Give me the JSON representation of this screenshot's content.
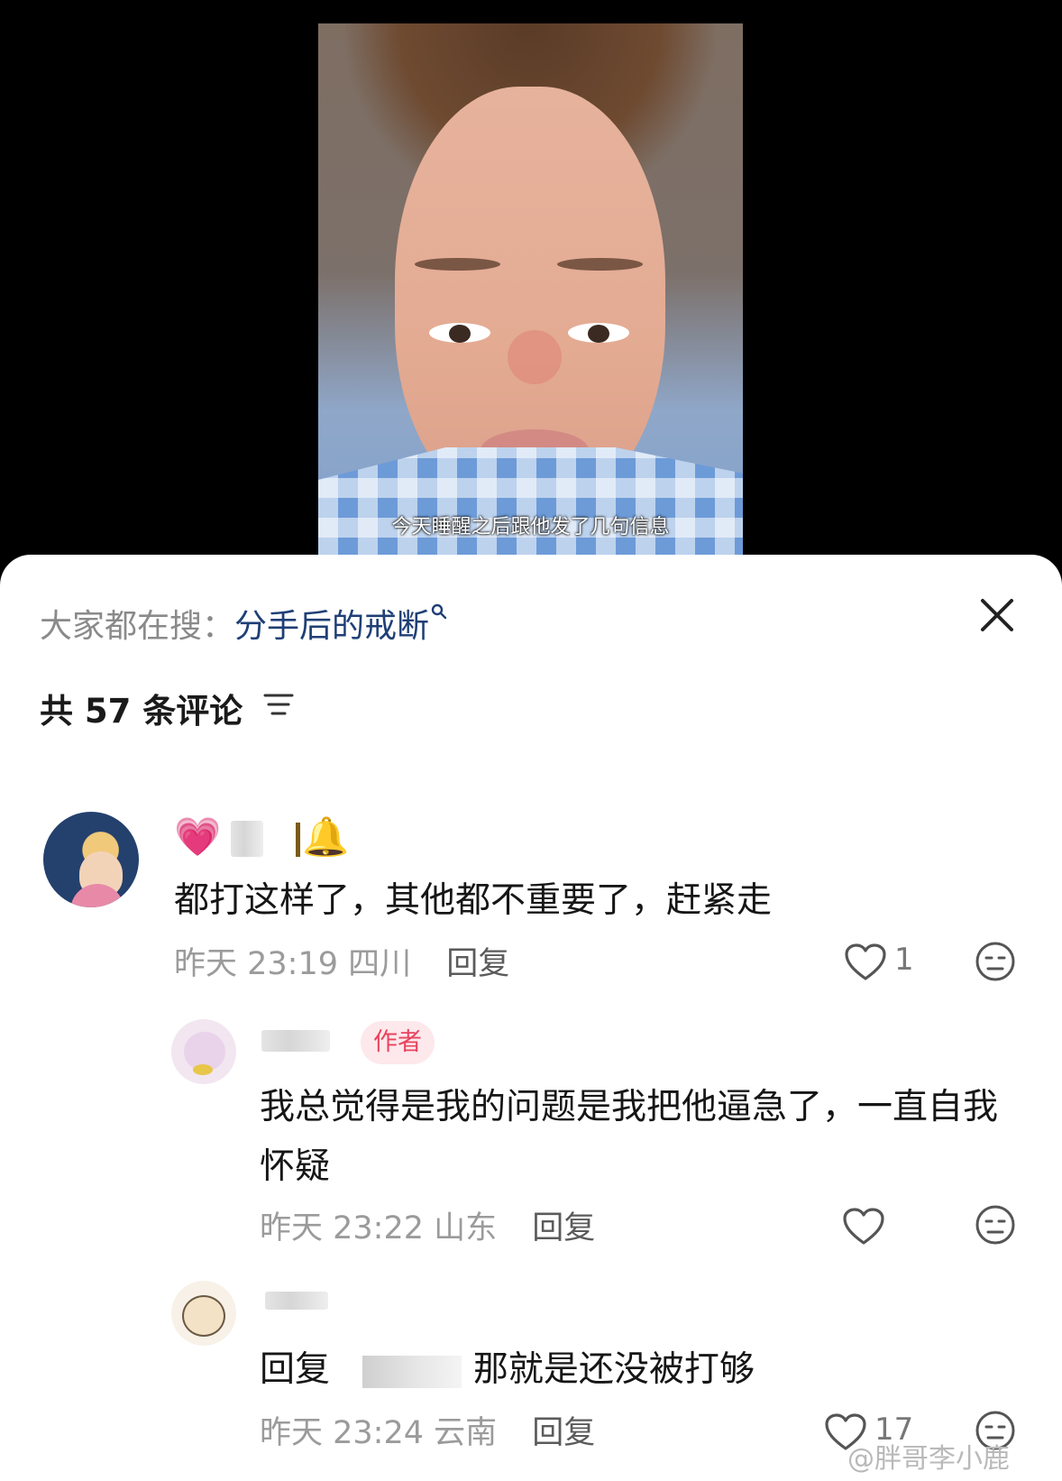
{
  "video": {
    "subtitle": "今天睡醒之后跟他发了几句信息"
  },
  "sheet": {
    "search_prefix": "大家都在搜：",
    "search_query": "分手后的戒断",
    "comment_count_label": "共 57 条评论"
  },
  "comments": [
    {
      "name_emoji_left": "💗",
      "name_emoji_right": "🔔",
      "text": "都打这样了，其他都不重要了，赶紧走",
      "time": "昨天 23:19",
      "location": "四川",
      "reply_label": "回复",
      "likes": "1"
    },
    {
      "author_badge": "作者",
      "text": "我总觉得是我的问题是我把他逼急了，一直自我怀疑",
      "time": "昨天 23:22",
      "location": "山东",
      "reply_label": "回复",
      "likes": ""
    },
    {
      "reply_prefix": "回复",
      "text": "那就是还没被打够",
      "time": "昨天 23:24",
      "location": "云南",
      "reply_label": "回复",
      "likes": "17"
    }
  ],
  "watermark": "@胖哥李小鹿",
  "icons": [
    "search-icon",
    "close-icon",
    "sort-icon",
    "heart-icon",
    "dislike-face-icon"
  ]
}
